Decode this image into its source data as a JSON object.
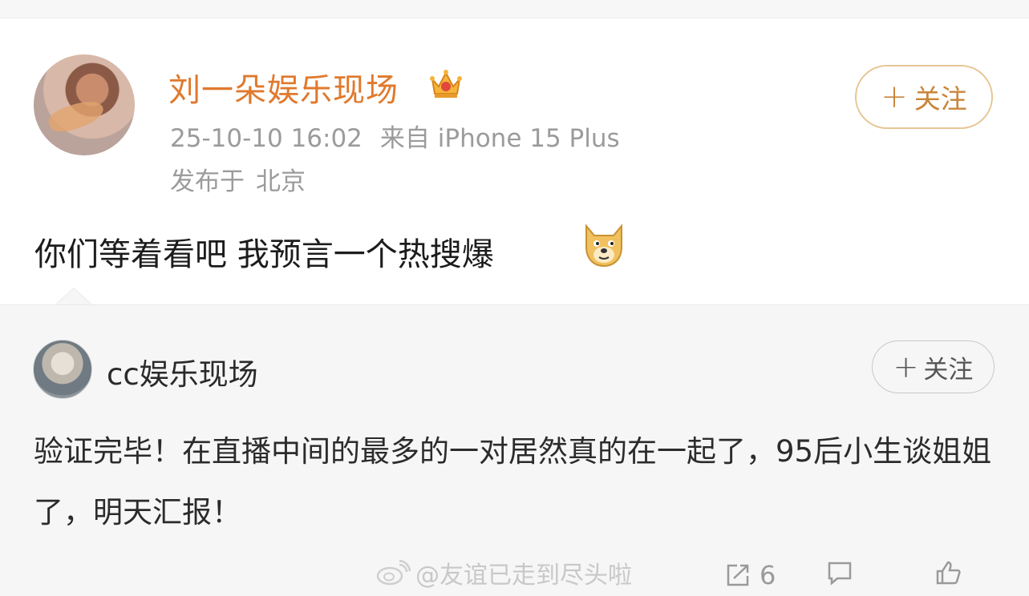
{
  "post": {
    "author": "刘一朵娱乐现场",
    "timestamp": "25-10-10 16:02",
    "source": "来自 iPhone 15 Plus",
    "location_label": "发布于",
    "location": "北京",
    "follow_label": "关注",
    "text": "你们等着看吧 我预言一个热搜爆",
    "emoji": "doge-icon"
  },
  "quote": {
    "author": "cc娱乐现场",
    "follow_label": "关注",
    "text": "验证完毕！在直播中间的最多的一对居然真的在一起了，95后小生谈姐姐了，明天汇报！"
  },
  "watermark": "@友谊已走到尽头啦",
  "stats": {
    "reposts": "6",
    "comments": "",
    "likes": ""
  },
  "colors": {
    "author_name": "#e0792d",
    "follow_border": "#e6c694",
    "meta_text": "#9b9b9b",
    "quote_bg": "#f6f6f6"
  }
}
